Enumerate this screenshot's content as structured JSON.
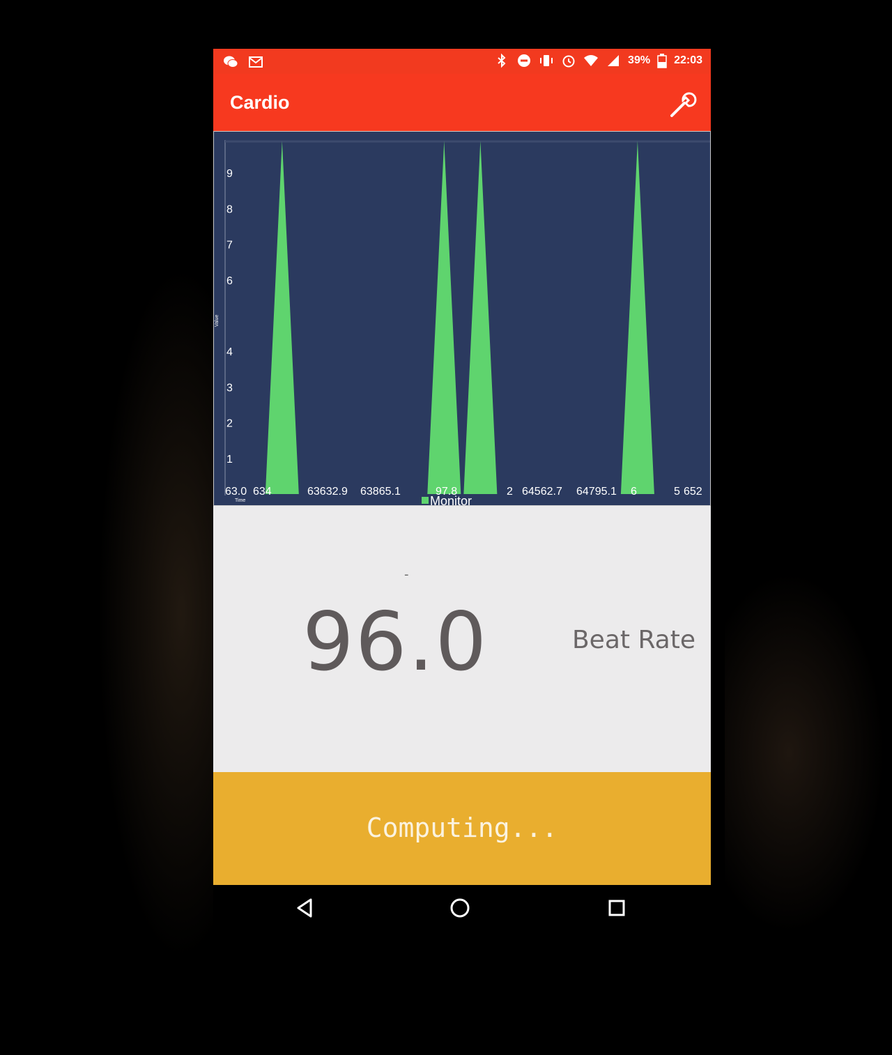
{
  "status_bar": {
    "battery": "39%",
    "time": "22:03",
    "left_icons": [
      "wechat-icon",
      "gmail-icon"
    ],
    "right_icons": [
      "bluetooth-icon",
      "do-not-disturb-icon",
      "vibrate-icon",
      "alarm-icon",
      "wifi-icon",
      "signal-icon",
      "battery-icon"
    ]
  },
  "app_bar": {
    "title": "Cardio",
    "settings_icon": "wrench-icon"
  },
  "chart_data": {
    "type": "area",
    "series": [
      {
        "name": "Monitor",
        "color": "#5fd46e"
      }
    ],
    "spikes_x": [
      63480,
      64150,
      64300,
      64950
    ],
    "y_ticks": [
      "9",
      "8",
      "7",
      "6",
      "4",
      "3",
      "2",
      "1"
    ],
    "x_tick_labels": [
      "63.0",
      "634",
      "63632.9",
      "63865.1",
      "97.8",
      "2",
      "64562.7",
      "64795.1",
      "6",
      "5",
      "652"
    ],
    "ylabel": "Value",
    "xlabel": "Time",
    "legend": "Monitor",
    "ylim": [
      0,
      10
    ],
    "colors": {
      "background": "#2b3a5f",
      "fill": "#5fd46e",
      "text": "#ffffff"
    }
  },
  "readout": {
    "indicator": "-",
    "value": "96.0",
    "label": "Beat Rate"
  },
  "status_panel": {
    "text": "Computing..."
  },
  "nav": {
    "icons": [
      "back-icon",
      "home-icon",
      "recents-icon"
    ]
  },
  "colors": {
    "primary": "#f7391f",
    "status_panel": "#e9ae2f",
    "readout_bg": "#ecebec"
  }
}
